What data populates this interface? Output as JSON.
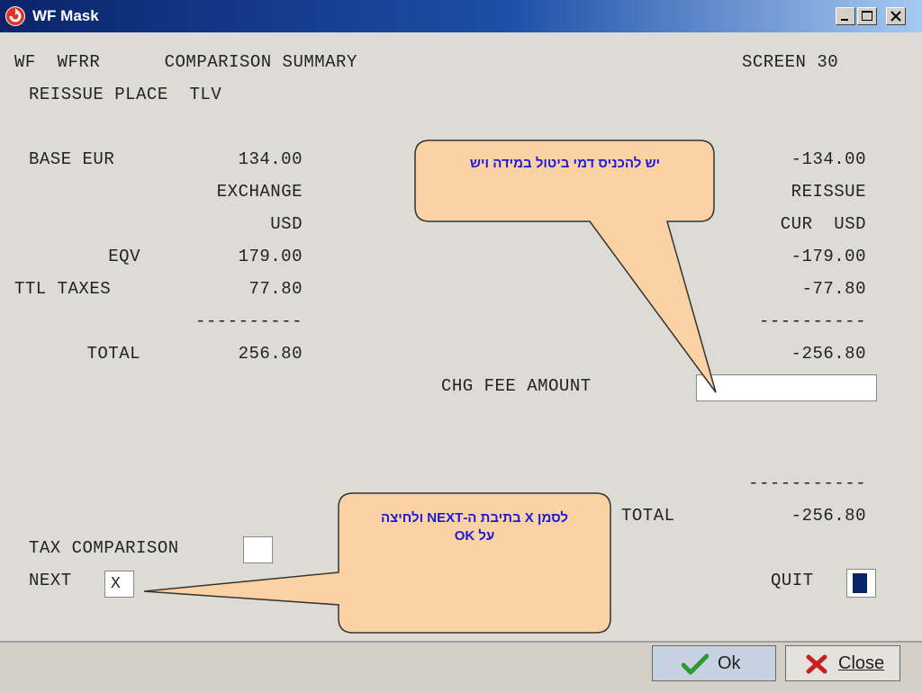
{
  "window": {
    "title": "WF Mask"
  },
  "header": {
    "left": "WF  WFRR      COMPARISON SUMMARY",
    "right": "SCREEN 30",
    "line2": "REISSUE PLACE  TLV"
  },
  "left_col": {
    "base_label": "BASE EUR",
    "base_value": "134.00",
    "exchange": "EXCHANGE",
    "currency": "USD",
    "eqv_label": "EQV",
    "eqv_value": "179.00",
    "taxes_label": "TTL TAXES",
    "taxes_value": "77.80",
    "dashes": "----------",
    "total_label": "TOTAL",
    "total_value": "256.80"
  },
  "right_col": {
    "base_value": "-134.00",
    "reissue": "REISSUE",
    "cur": "CUR  USD",
    "eqv_value": "-179.00",
    "taxes_value": "-77.80",
    "dashes": "----------",
    "total_value": "-256.80",
    "chg_fee_label": "CHG FEE AMOUNT",
    "dashes2": "-----------",
    "total2_label": "TOTAL",
    "total2_value": "-256.80"
  },
  "bottom_fields": {
    "tax_comparison_label": "TAX COMPARISON",
    "next_label": "NEXT",
    "next_value": "X",
    "quit_label": "QUIT"
  },
  "callouts": {
    "top": "יש להכניס דמי ביטול במידה ויש",
    "bottom_line1": "לסמן X בתיבת ה-NEXT ולחיצה",
    "bottom_line2": "על OK"
  },
  "buttons": {
    "ok": "Ok",
    "close": "Close"
  },
  "colors": {
    "callout_fill": "#fcd2a4",
    "callout_text": "#1a1adc",
    "ok_check": "#2c9a2c",
    "close_x": "#c81e1e"
  }
}
